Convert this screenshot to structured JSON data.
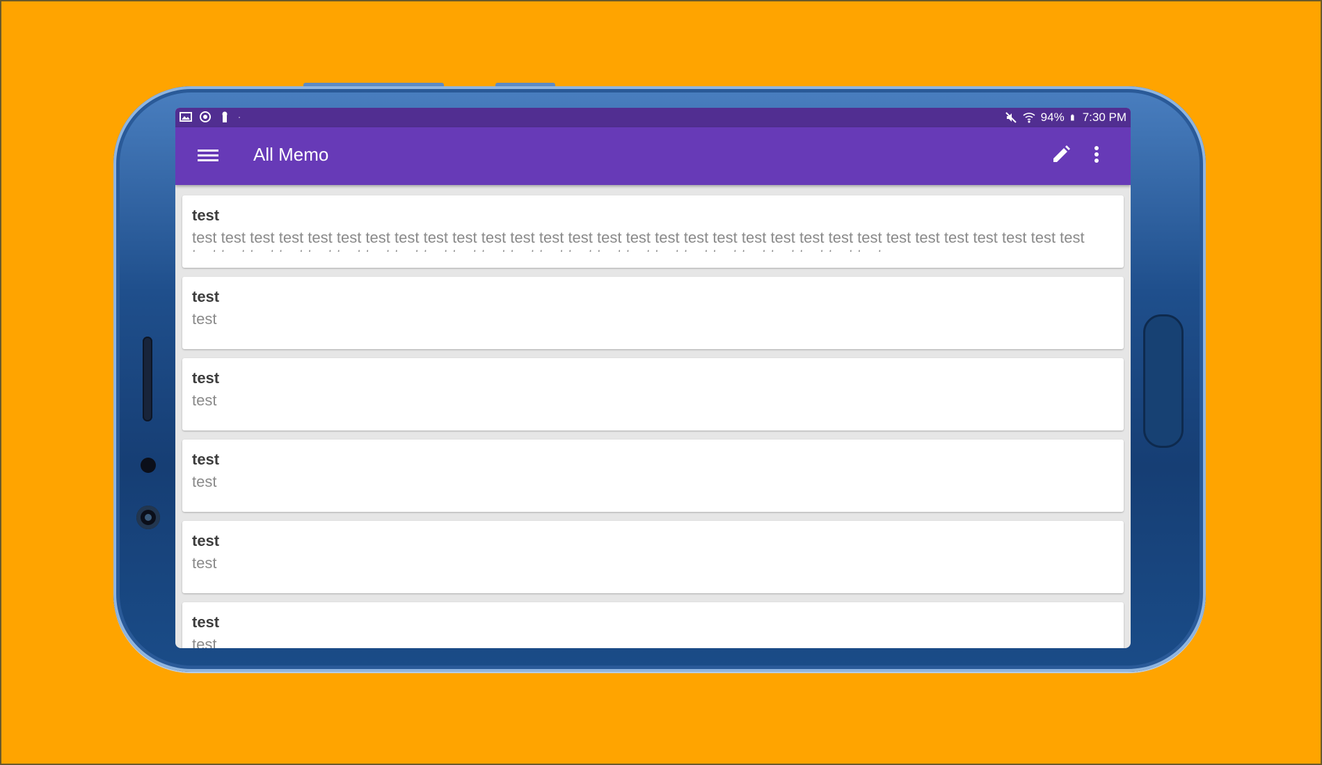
{
  "status_bar": {
    "battery": "94%",
    "time": "7:30 PM",
    "left_icons": [
      "image-icon",
      "alarm-icon",
      "keyhole-icon"
    ],
    "right_icons": [
      "mute-icon",
      "wifi-icon",
      "battery-icon"
    ]
  },
  "app_bar": {
    "title": "All Memo",
    "menu_icon": "hamburger-menu-icon",
    "edit_icon": "pencil-icon",
    "more_icon": "more-vert-icon"
  },
  "memos": [
    {
      "title": "test",
      "body": "test test test test test test test test test test test test test test test test test test test test test test test test test test test test test test test test test test test test test test test test test test test test test test test test test test test test test test test"
    },
    {
      "title": "test",
      "body": "test"
    },
    {
      "title": "test",
      "body": "test"
    },
    {
      "title": "test",
      "body": "test"
    },
    {
      "title": "test",
      "body": "test"
    },
    {
      "title": "test",
      "body": "test"
    }
  ],
  "colors": {
    "background": "#FFA400",
    "status_bar": "#512E91",
    "app_bar": "#673AB7",
    "phone_body": "#1F4F8C"
  }
}
